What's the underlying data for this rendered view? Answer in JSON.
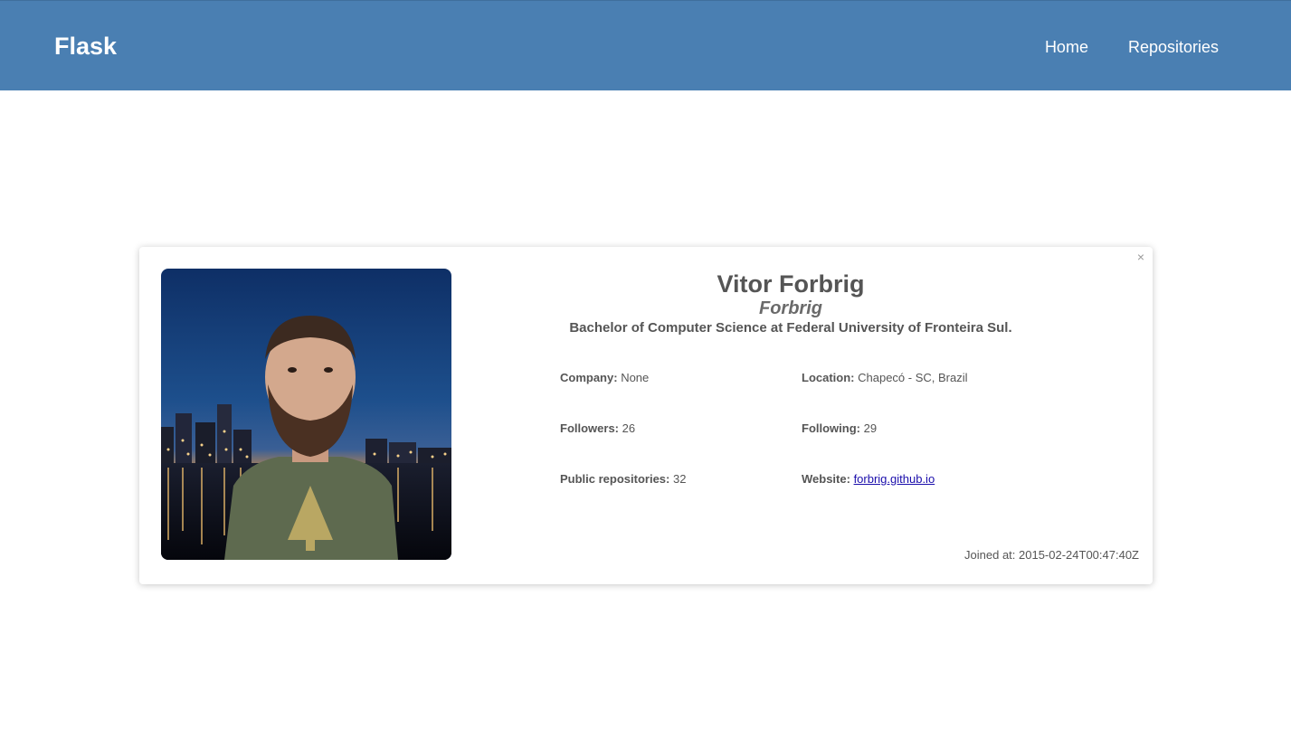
{
  "nav": {
    "brand": "Flask",
    "links": [
      "Home",
      "Repositories"
    ]
  },
  "profile": {
    "close_symbol": "×",
    "name": "Vitor Forbrig",
    "login": "Forbrig",
    "bio": "Bachelor of Computer Science at Federal University of Fronteira Sul.",
    "company_label": "Company:",
    "company": "None",
    "location_label": "Location:",
    "location": "Chapecó - SC, Brazil",
    "followers_label": "Followers:",
    "followers": "26",
    "following_label": "Following:",
    "following": "29",
    "repos_label": "Public repositories:",
    "repos": "32",
    "website_label": "Website:",
    "website": "forbrig.github.io",
    "joined": "Joined at: 2015-02-24T00:47:40Z"
  },
  "colors": {
    "navbar": "#4a7fb2",
    "text": "#555555",
    "link": "#1a0dab"
  }
}
